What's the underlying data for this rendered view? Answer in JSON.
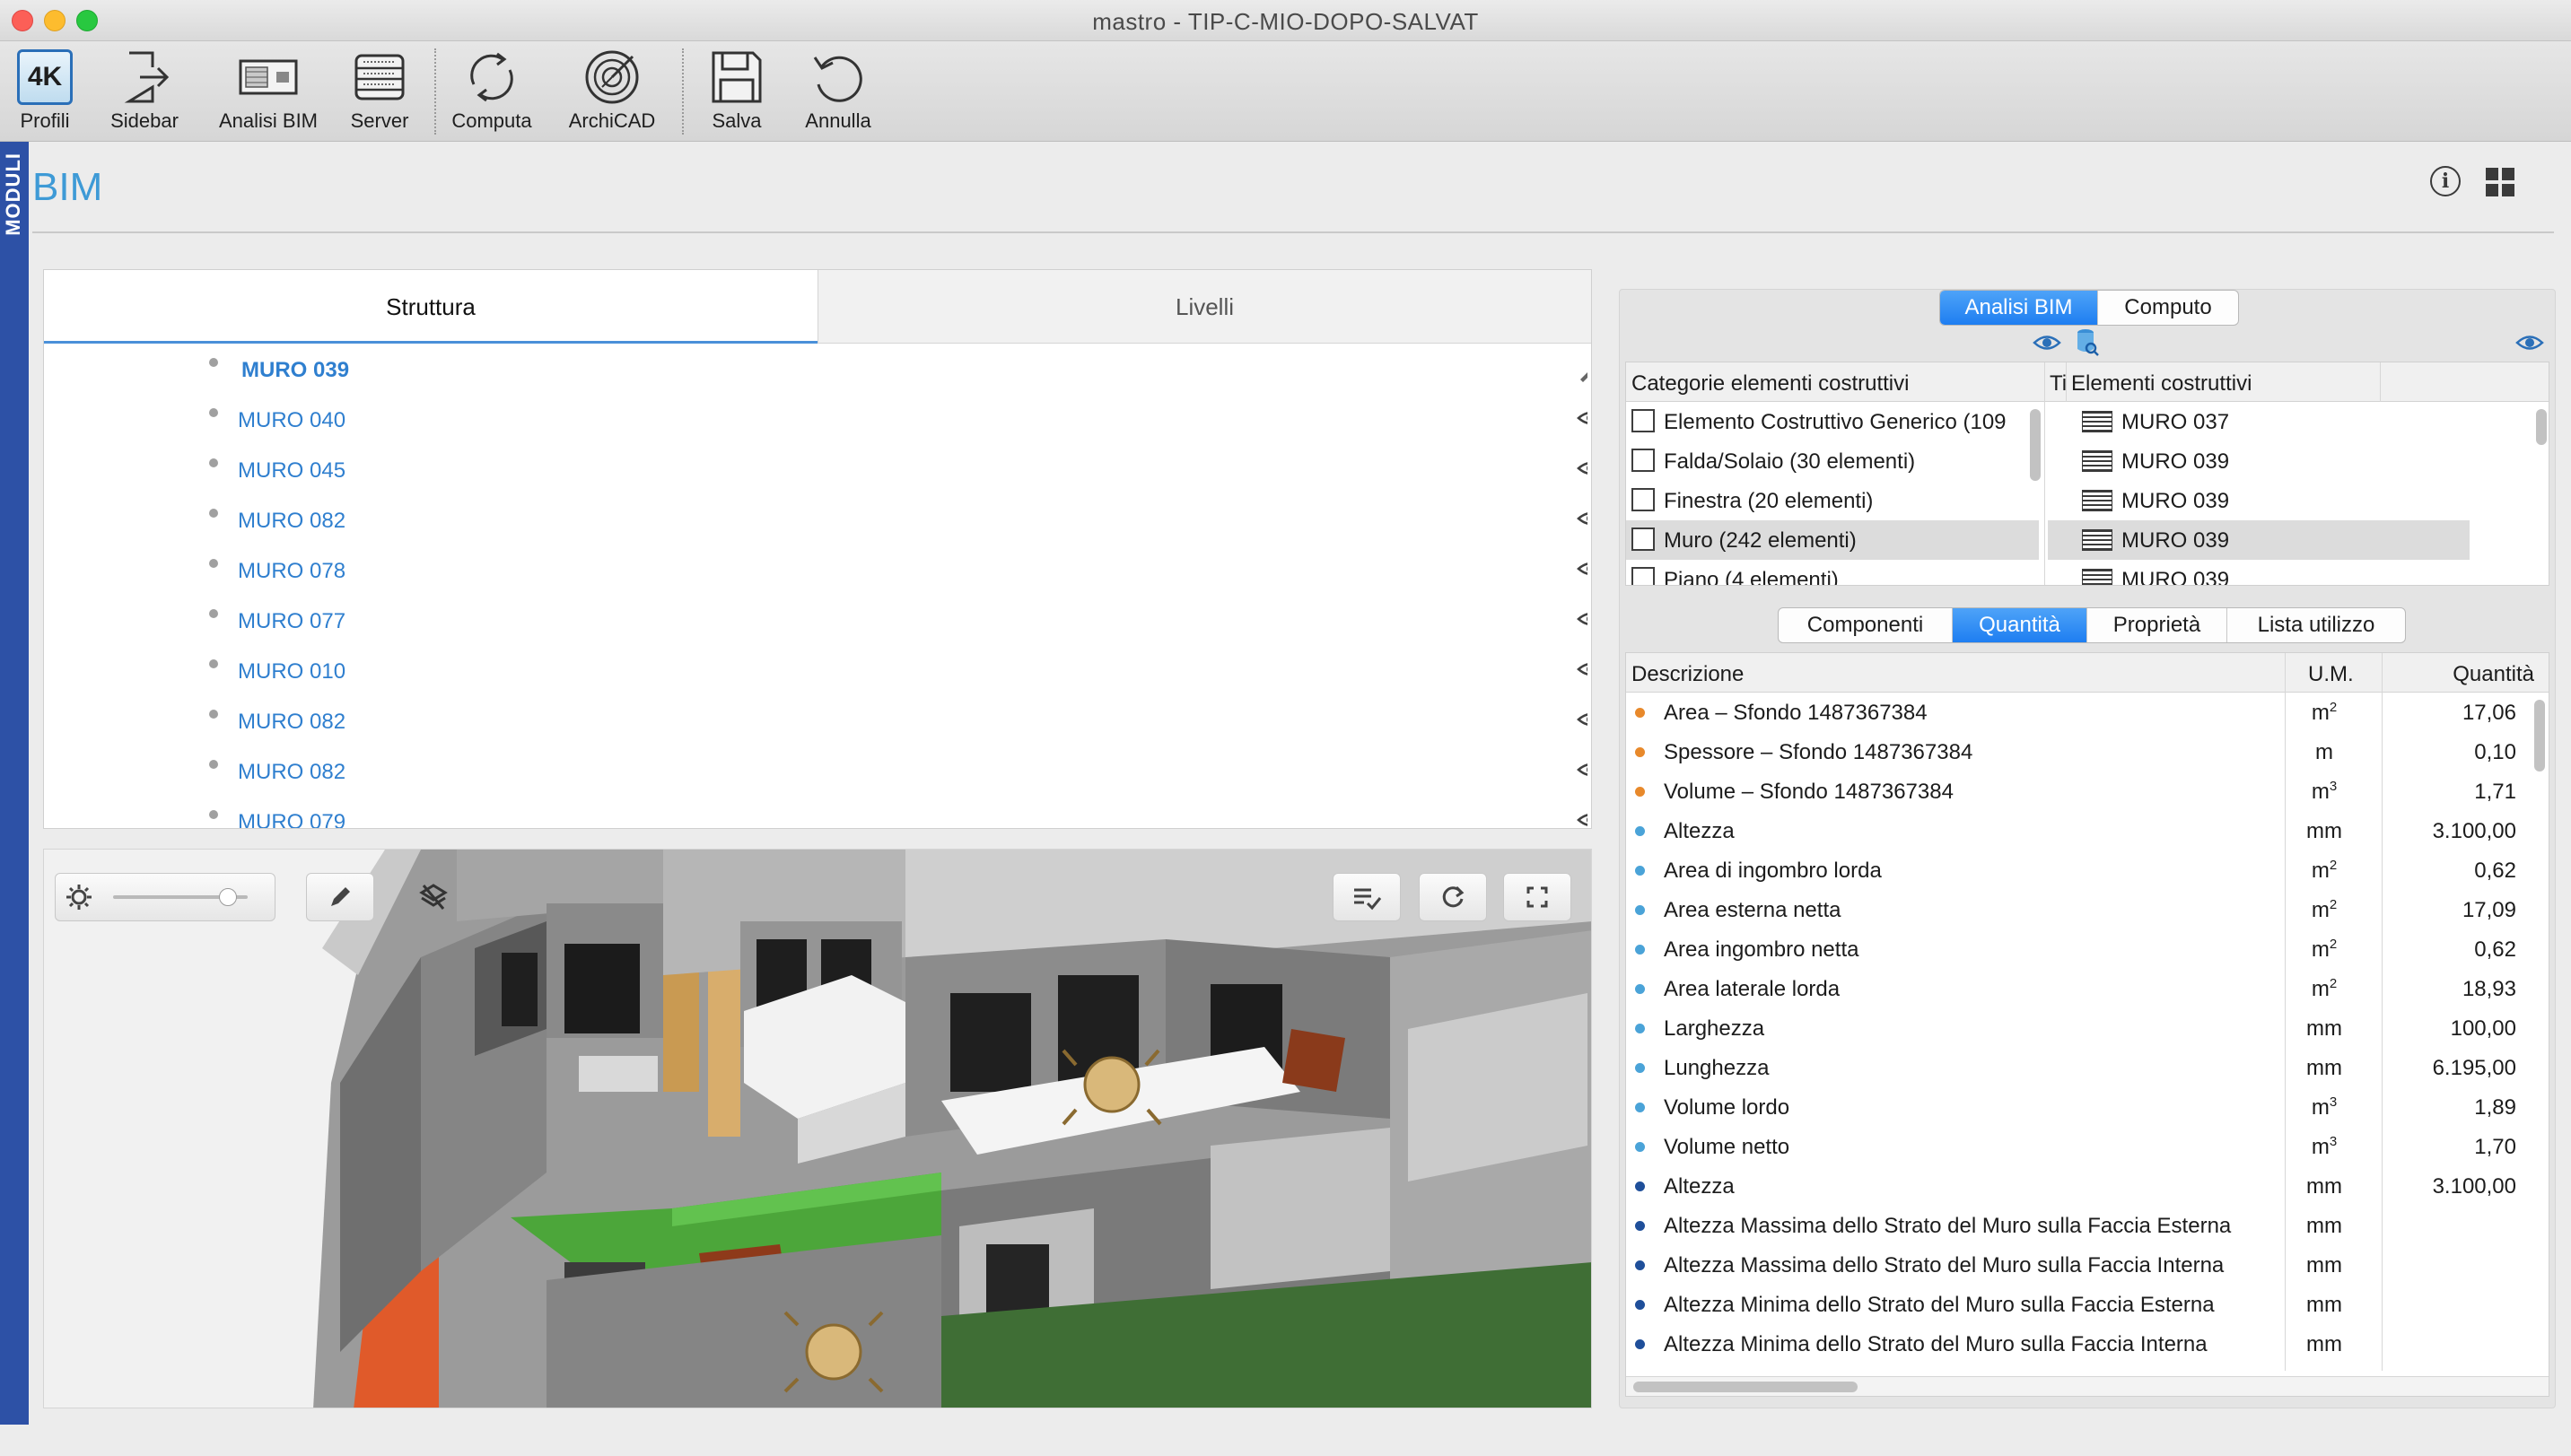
{
  "window": {
    "title": "mastro - TIP-C-MIO-DOPO-SALVAT"
  },
  "toolbar": {
    "profili_badge": "4K",
    "items": [
      {
        "label": "Profili",
        "icon": "profiles-icon"
      },
      {
        "label": "Sidebar",
        "icon": "sidebar-icon"
      },
      {
        "label": "Analisi BIM",
        "icon": "bim-analysis-icon"
      },
      {
        "label": "Server",
        "icon": "server-icon"
      },
      {
        "label": "Computa",
        "icon": "compute-icon"
      },
      {
        "label": "ArchiCAD",
        "icon": "archicad-icon"
      },
      {
        "label": "Salva",
        "icon": "save-icon"
      },
      {
        "label": "Annulla",
        "icon": "undo-icon"
      }
    ]
  },
  "side": {
    "moduli_label": "MODULI"
  },
  "header": {
    "title": "BIM",
    "info_glyph": "i"
  },
  "tree": {
    "tabs": [
      "Struttura",
      "Livelli"
    ],
    "rows": [
      {
        "label": "MURO 039",
        "selected": true
      },
      {
        "label": "MURO 040"
      },
      {
        "label": "MURO 045"
      },
      {
        "label": "MURO 082"
      },
      {
        "label": "MURO 078"
      },
      {
        "label": "MURO 077"
      },
      {
        "label": "MURO 010"
      },
      {
        "label": "MURO 082"
      },
      {
        "label": "MURO 082"
      },
      {
        "label": "MURO 079"
      }
    ]
  },
  "right": {
    "top_tabs": [
      {
        "label": "Analisi BIM",
        "active": true
      },
      {
        "label": "Computo",
        "active": false
      }
    ],
    "categories_header": "Categorie elementi costruttivi",
    "tipo_header": "Ti",
    "elements_header": "Elementi costruttivi",
    "categories": [
      {
        "label": "Elemento Costruttivo Generico  (109"
      },
      {
        "label": "Falda/Solaio  (30 elementi)"
      },
      {
        "label": "Finestra  (20 elementi)"
      },
      {
        "label": "Muro  (242 elementi)",
        "selected": true
      },
      {
        "label": "Piano  (4 elementi)"
      }
    ],
    "elements": [
      {
        "label": "MURO 037"
      },
      {
        "label": "MURO 039"
      },
      {
        "label": "MURO 039"
      },
      {
        "label": "MURO 039",
        "selected": true
      },
      {
        "label": "MURO 039"
      }
    ],
    "sub_tabs": [
      {
        "label": "Componenti",
        "active": false
      },
      {
        "label": "Quantità",
        "active": true
      },
      {
        "label": "Proprietà",
        "active": false
      },
      {
        "label": "Lista utilizzo",
        "active": false
      }
    ],
    "qty_headers": {
      "desc": "Descrizione",
      "um": "U.M.",
      "qty": "Quantità"
    },
    "qty_rows": [
      {
        "dot": "#e8892b",
        "desc": "Area – Sfondo 1487367384",
        "um": "m",
        "exp": "2",
        "val": "17,06"
      },
      {
        "dot": "#e8892b",
        "desc": "Spessore – Sfondo 1487367384",
        "um": "m",
        "exp": "",
        "val": "0,10"
      },
      {
        "dot": "#e8892b",
        "desc": "Volume – Sfondo 1487367384",
        "um": "m",
        "exp": "3",
        "val": "1,71"
      },
      {
        "dot": "#4aa3d8",
        "desc": "Altezza",
        "um": "mm",
        "exp": "",
        "val": "3.100,00"
      },
      {
        "dot": "#4aa3d8",
        "desc": "Area di ingombro lorda",
        "um": "m",
        "exp": "2",
        "val": "0,62"
      },
      {
        "dot": "#4aa3d8",
        "desc": "Area esterna netta",
        "um": "m",
        "exp": "2",
        "val": "17,09"
      },
      {
        "dot": "#4aa3d8",
        "desc": "Area ingombro netta",
        "um": "m",
        "exp": "2",
        "val": "0,62"
      },
      {
        "dot": "#4aa3d8",
        "desc": "Area laterale lorda",
        "um": "m",
        "exp": "2",
        "val": "18,93"
      },
      {
        "dot": "#4aa3d8",
        "desc": "Larghezza",
        "um": "mm",
        "exp": "",
        "val": "100,00"
      },
      {
        "dot": "#4aa3d8",
        "desc": "Lunghezza",
        "um": "mm",
        "exp": "",
        "val": "6.195,00"
      },
      {
        "dot": "#4aa3d8",
        "desc": "Volume lordo",
        "um": "m",
        "exp": "3",
        "val": "1,89"
      },
      {
        "dot": "#4aa3d8",
        "desc": "Volume netto",
        "um": "m",
        "exp": "3",
        "val": "1,70"
      },
      {
        "dot": "#1f4f9a",
        "desc": "Altezza",
        "um": "mm",
        "exp": "",
        "val": "3.100,00"
      },
      {
        "dot": "#1f4f9a",
        "desc": "Altezza Massima dello Strato del Muro sulla Faccia Esterna",
        "um": "mm",
        "exp": "",
        "val": ""
      },
      {
        "dot": "#1f4f9a",
        "desc": "Altezza Massima dello Strato del Muro sulla Faccia Interna",
        "um": "mm",
        "exp": "",
        "val": ""
      },
      {
        "dot": "#1f4f9a",
        "desc": "Altezza Minima dello Strato del Muro sulla Faccia Esterna",
        "um": "mm",
        "exp": "",
        "val": ""
      },
      {
        "dot": "#1f4f9a",
        "desc": "Altezza Minima dello Strato del Muro sulla Faccia Interna",
        "um": "mm",
        "exp": "",
        "val": ""
      }
    ]
  },
  "viewport": {
    "brightness_level": 0.85
  }
}
